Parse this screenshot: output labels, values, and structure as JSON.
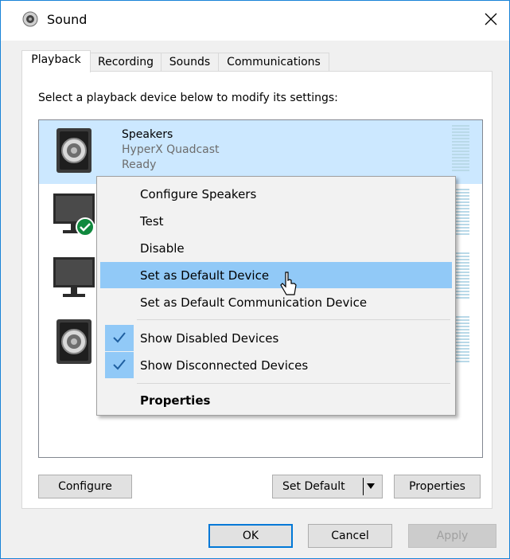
{
  "window": {
    "title": "Sound"
  },
  "tabs": [
    {
      "label": "Playback"
    },
    {
      "label": "Recording"
    },
    {
      "label": "Sounds"
    },
    {
      "label": "Communications"
    }
  ],
  "instruction": "Select a playback device below to modify its settings:",
  "devices": [
    {
      "name": "Speakers",
      "sub": "HyperX Quadcast",
      "status": "Ready",
      "icon": "speaker-icon"
    },
    {
      "icon": "monitor-default-icon"
    },
    {
      "icon": "monitor-icon"
    },
    {
      "icon": "speaker-icon"
    }
  ],
  "context_menu": {
    "items": [
      {
        "label": "Configure Speakers"
      },
      {
        "label": "Test"
      },
      {
        "label": "Disable"
      },
      {
        "label": "Set as Default Device",
        "highlighted": true
      },
      {
        "label": "Set as Default Communication Device"
      },
      {
        "label": "Show Disabled Devices",
        "checked": true
      },
      {
        "label": "Show Disconnected Devices",
        "checked": true
      },
      {
        "label": "Properties",
        "bold": true
      }
    ]
  },
  "buttons": {
    "configure": "Configure",
    "set_default": "Set Default",
    "properties": "Properties",
    "ok": "OK",
    "cancel": "Cancel",
    "apply": "Apply"
  },
  "colors": {
    "selection": "#cce8ff",
    "menu_highlight": "#91c9f7",
    "accent": "#0078d7",
    "default_badge": "#10893e"
  }
}
